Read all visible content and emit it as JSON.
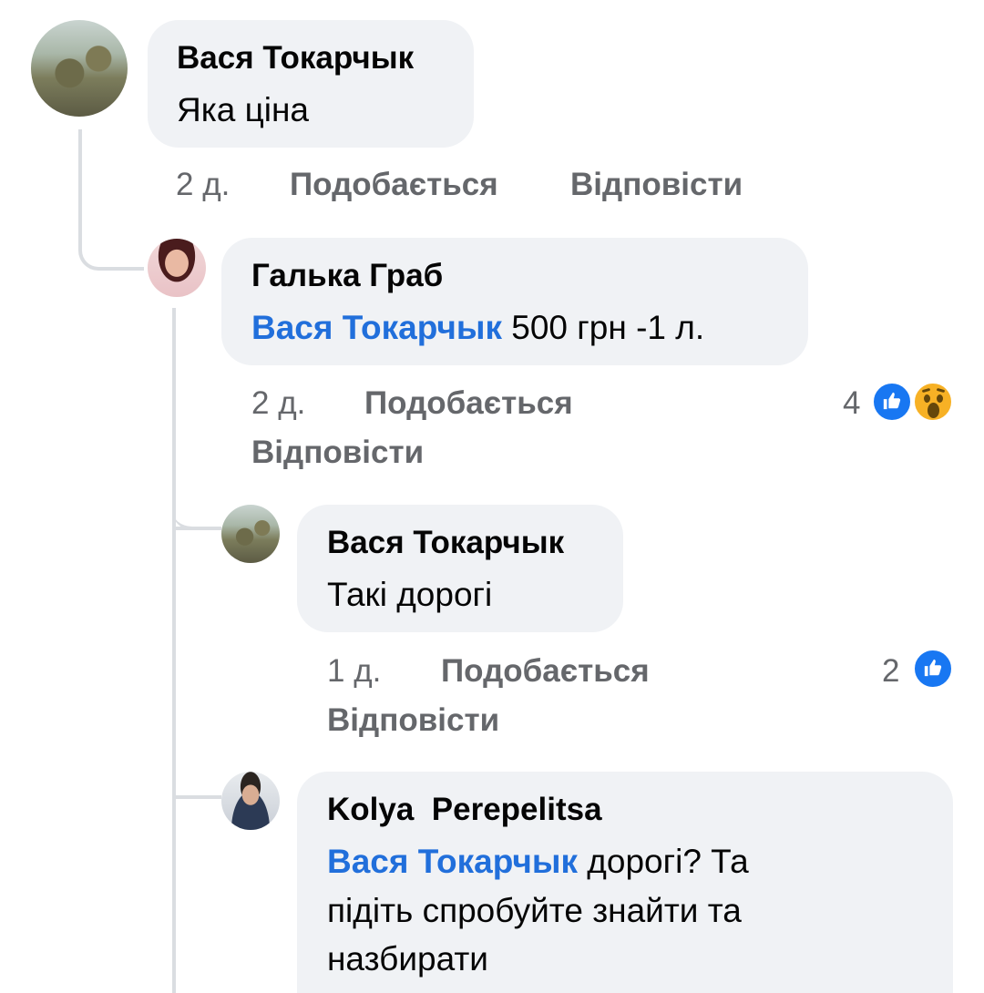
{
  "comments": [
    {
      "author": "Вася Токарчык",
      "text": "Яка ціна",
      "time": "2 д.",
      "like": "Подобається",
      "reply": "Відповісти"
    },
    {
      "author": "Галька Граб",
      "mention": "Вася Токарчык",
      "text": " 500 грн -1 л.",
      "time": "2 д.",
      "like": "Подобається",
      "reply": "Відповісти",
      "reaction_count": "4",
      "reactions": [
        "like-icon",
        "wow-icon"
      ]
    },
    {
      "author": "Вася Токарчык",
      "text": "Такі дорогі",
      "time": "1 д.",
      "like": "Подобається",
      "reply": "Відповісти",
      "reaction_count": "2",
      "reactions": [
        "like-icon"
      ]
    },
    {
      "author": "Kolya  Perepelitsa",
      "mention": "Вася Токарчык",
      "text_line1": " дорогі? Та",
      "text_line2": "підіть спробуйте знайти та",
      "text_line3": "назбирати"
    }
  ],
  "colors": {
    "bubble": "#f0f2f5",
    "mention": "#216fdb",
    "meta": "#65676b",
    "like": "#1877f2",
    "wow": "#f7b125",
    "thread_line": "#dadde1"
  }
}
